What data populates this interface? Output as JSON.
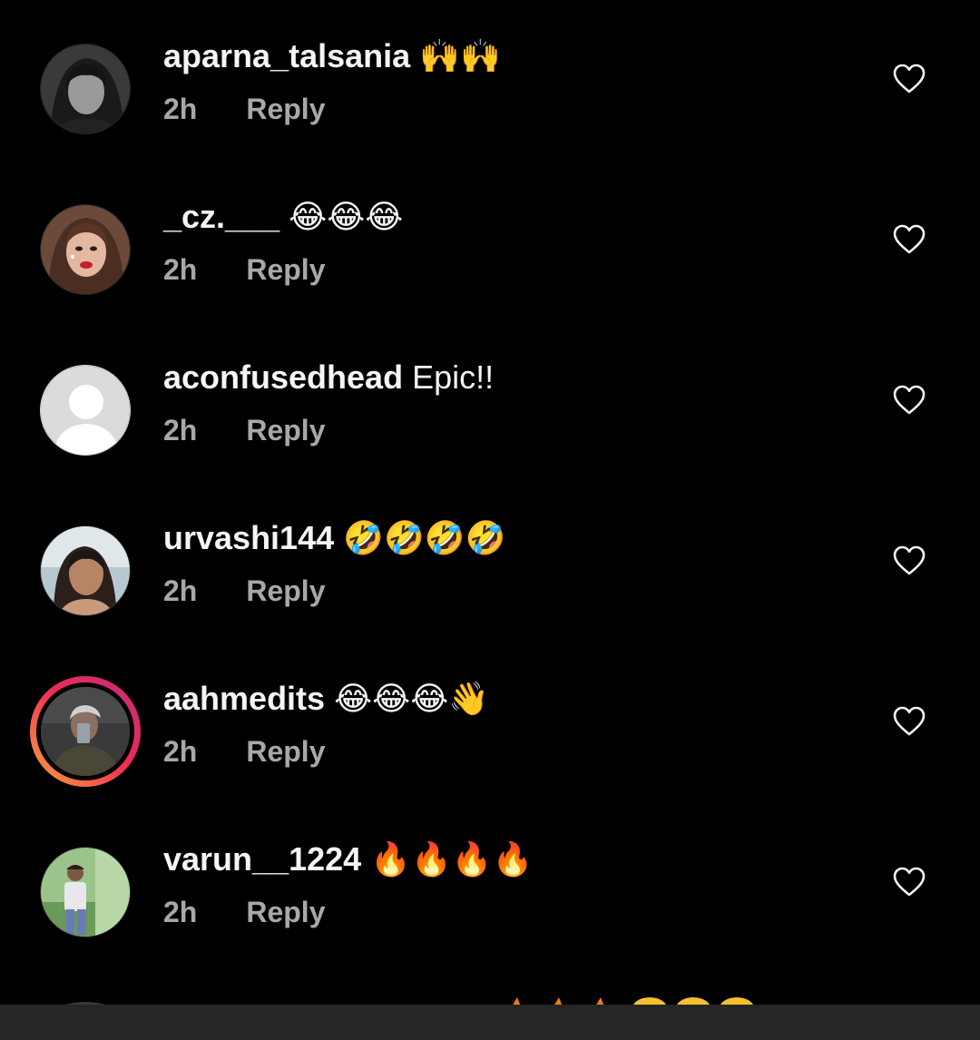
{
  "comments": [
    {
      "username": "aparna_talsania",
      "text": "🙌🙌",
      "time": "2h",
      "reply": "Reply",
      "avatar": "bw-portrait",
      "story_ring": false
    },
    {
      "username": "_cz.___",
      "text": "😂😂😂",
      "time": "2h",
      "reply": "Reply",
      "avatar": "cartoon-portrait",
      "story_ring": false
    },
    {
      "username": "aconfusedhead",
      "text": "Epic!!",
      "time": "2h",
      "reply": "Reply",
      "avatar": "default-avatar",
      "story_ring": false
    },
    {
      "username": "urvashi144",
      "text": "🤣🤣🤣🤣",
      "time": "2h",
      "reply": "Reply",
      "avatar": "photo-portrait",
      "story_ring": false
    },
    {
      "username": "aahmedits",
      "text": "😂😂😂👋",
      "time": "2h",
      "reply": "Reply",
      "avatar": "selfie-portrait",
      "story_ring": true
    },
    {
      "username": "varun__1224",
      "text": "🔥🔥🔥🔥",
      "time": "2h",
      "reply": "Reply",
      "avatar": "outdoor-portrait",
      "story_ring": false
    }
  ],
  "icons": {
    "like": "heart-outline-icon"
  },
  "colors": {
    "background": "#000000",
    "primary_text": "#f5f5f5",
    "secondary_text": "#a8a8a8",
    "story_ring_start": "#f9a53c",
    "story_ring_end": "#c02d7f",
    "bottom_bar": "#262626"
  }
}
